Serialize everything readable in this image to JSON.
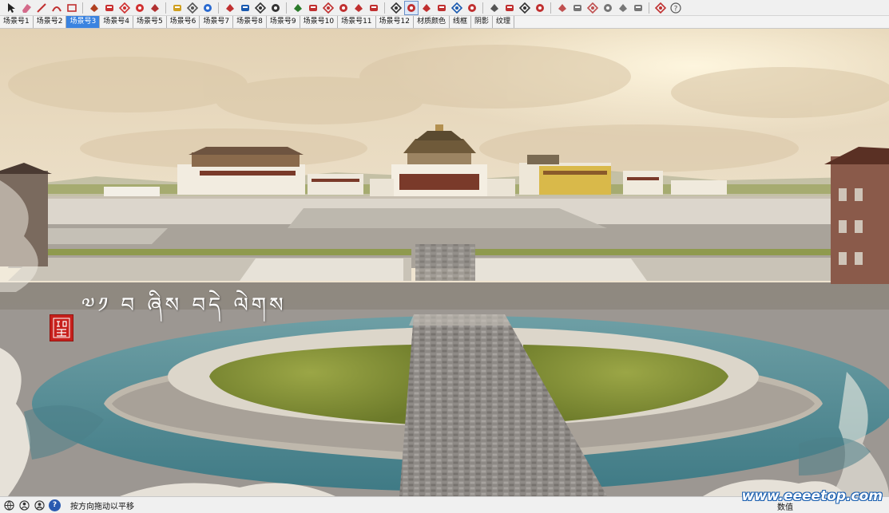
{
  "toolbar": {
    "tools": [
      {
        "name": "select-icon",
        "color": "#222222"
      },
      {
        "name": "eraser-icon",
        "color": "#d46a8a"
      },
      {
        "name": "pencil-line-icon",
        "color": "#c03030"
      },
      {
        "name": "arc-icon",
        "color": "#c03030"
      },
      {
        "name": "rectangle-icon",
        "color": "#c03030"
      },
      {
        "name": "push-pull-icon",
        "color": "#b04020"
      },
      {
        "name": "follow-me-icon",
        "color": "#c83030"
      },
      {
        "name": "move-icon",
        "color": "#d03030"
      },
      {
        "name": "rotate-icon",
        "color": "#d03030"
      },
      {
        "name": "scale-icon",
        "color": "#b03030"
      },
      {
        "name": "tape-measure-icon",
        "color": "#d0a020"
      },
      {
        "name": "text-icon",
        "color": "#555555"
      },
      {
        "name": "paint-bucket-icon",
        "color": "#2a6ad0"
      },
      {
        "name": "orbit-icon",
        "color": "#c03030"
      },
      {
        "name": "pan-icon",
        "color": "#1a5ab0"
      },
      {
        "name": "zoom-icon",
        "color": "#333333"
      },
      {
        "name": "zoom-extents-icon",
        "color": "#333333"
      },
      {
        "name": "component-icon",
        "color": "#2a7a2a"
      },
      {
        "name": "section-plane-icon",
        "color": "#c03030"
      },
      {
        "name": "warehouse-icon",
        "color": "#c03030"
      },
      {
        "name": "extension-icon",
        "color": "#c03030"
      },
      {
        "name": "share-model-icon",
        "color": "#c03030"
      },
      {
        "name": "binoculars-icon",
        "color": "#c03030"
      },
      {
        "name": "zoom-window-icon",
        "color": "#333333"
      },
      {
        "name": "previous-view-icon",
        "color": "#c03030"
      },
      {
        "name": "next-view-icon",
        "color": "#c03030"
      },
      {
        "name": "walk-icon",
        "color": "#c03030"
      },
      {
        "name": "look-around-icon",
        "color": "#1a5ab0"
      },
      {
        "name": "position-camera-icon",
        "color": "#c03030"
      },
      {
        "name": "sandbox-icon",
        "color": "#555555"
      },
      {
        "name": "undo-icon",
        "color": "#c03030"
      },
      {
        "name": "redo-icon",
        "color": "#333333"
      },
      {
        "name": "flag-icon",
        "color": "#c03030"
      },
      {
        "name": "iso-view-icon",
        "color": "#c05050"
      },
      {
        "name": "top-view-icon",
        "color": "#777777"
      },
      {
        "name": "front-view-icon",
        "color": "#c05050"
      },
      {
        "name": "right-view-icon",
        "color": "#777777"
      },
      {
        "name": "back-view-icon",
        "color": "#777777"
      },
      {
        "name": "left-view-icon",
        "color": "#777777"
      },
      {
        "name": "solid-style-icon",
        "color": "#c03030"
      },
      {
        "name": "help-icon",
        "color": "#555555"
      }
    ],
    "active_tool_index": 24
  },
  "tabs": [
    {
      "label": "场景号1"
    },
    {
      "label": "场景号2"
    },
    {
      "label": "场景号3"
    },
    {
      "label": "场景号4"
    },
    {
      "label": "场景号5"
    },
    {
      "label": "场景号6"
    },
    {
      "label": "场景号7"
    },
    {
      "label": "场景号8"
    },
    {
      "label": "场景号9"
    },
    {
      "label": "场景号10"
    },
    {
      "label": "场景号11"
    },
    {
      "label": "场景号12"
    },
    {
      "label": "材质颜色"
    },
    {
      "label": "线框"
    },
    {
      "label": "阴影"
    },
    {
      "label": "纹理"
    }
  ],
  "selected_tab_index": 2,
  "viewport": {
    "overlay_text": "༧༡ བ ཞིས བདེ ལེགས",
    "seal_text": "藏"
  },
  "status": {
    "hint_text": "按方向拖动以平移",
    "right_label": "数值"
  },
  "watermark": "www.eeeetop.com"
}
